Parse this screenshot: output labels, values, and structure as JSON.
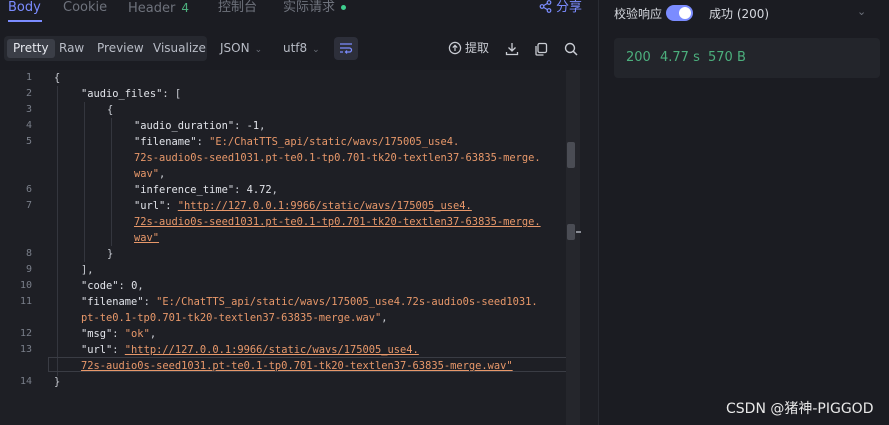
{
  "tabs": [
    {
      "label": "Body",
      "active": true
    },
    {
      "label": "Cookie"
    },
    {
      "label": "Header",
      "count": "4"
    },
    {
      "label": "控制台"
    },
    {
      "label": "实际请求"
    }
  ],
  "share_label": "分享",
  "view_modes": [
    "Pretty",
    "Raw",
    "Preview",
    "Visualize"
  ],
  "format_select": "JSON",
  "encoding_select": "utf8",
  "extract_label": "提取",
  "gutter": [
    "1",
    "2",
    "3",
    "4",
    "5",
    "",
    "",
    "6",
    "7",
    "",
    "",
    "8",
    "9",
    "10",
    "11",
    "",
    "12",
    "13",
    "",
    "14"
  ],
  "json_lines": [
    "{",
    "\"audio_files\": [",
    "{",
    "\"audio_duration\": -1,",
    "\"filename\": \"E:/ChatTTS_api/static/wavs/175005_use4.",
    "72s-audio0s-seed1031.pt-te0.1-tp0.701-tk20-textlen37-63835-merge.",
    "wav\",",
    "\"inference_time\": 4.72,",
    "\"url\": \"http://127.0.0.1:9966/static/wavs/175005_use4.",
    "72s-audio0s-seed1031.pt-te0.1-tp0.701-tk20-textlen37-63835-merge.",
    "wav\"",
    "}",
    "],",
    "\"code\": 0,",
    "\"filename\": \"E:/ChatTTS_api/static/wavs/175005_use4.72s-audio0s-seed1031.",
    "pt-te0.1-tp0.701-tk20-textlen37-63835-merge.wav\",",
    "\"msg\": \"ok\",",
    "\"url\": \"http://127.0.0.1:9966/static/wavs/175005_use4.",
    "72s-audio0s-seed1031.pt-te0.1-tp0.701-tk20-textlen37-63835-merge.wav\"",
    "}"
  ],
  "code": {
    "audio_files_key": "\"audio_files\"",
    "audio_duration_key": "\"audio_duration\"",
    "audio_duration_val": "-1",
    "filename_key": "\"filename\"",
    "filename1_a": "\"E:/ChatTTS_api/static/wavs/175005_use4.",
    "filename1_b": "72s-audio0s-seed1031.pt-te0.1-tp0.701-tk20-textlen37-63835-merge.",
    "filename1_c": "wav\"",
    "inference_time_key": "\"inference_time\"",
    "inference_time_val": "4.72",
    "url_key": "\"url\"",
    "url1_a": "\"http://127.0.0.1:9966/static/wavs/175005_use4.",
    "url1_b": "72s-audio0s-seed1031.pt-te0.1-tp0.701-tk20-textlen37-63835-merge.",
    "url1_c": "wav\"",
    "code_key": "\"code\"",
    "code_val": "0",
    "filename2_a": "\"E:/ChatTTS_api/static/wavs/175005_use4.72s-audio0s-seed1031.",
    "filename2_b": "pt-te0.1-tp0.701-tk20-textlen37-63835-merge.wav\"",
    "msg_key": "\"msg\"",
    "msg_val": "\"ok\"",
    "url2_a": "\"http://127.0.0.1:9966/static/wavs/175005_use4.",
    "url2_b": "72s-audio0s-seed1031.pt-te0.1-tp0.701-tk20-textlen37-63835-merge.wav\""
  },
  "response": {
    "verify_label": "校验响应",
    "verify_enabled": true,
    "result": "成功 (200)",
    "status": "200",
    "time": "4.77 s",
    "size": "570 B"
  },
  "watermark": "CSDN @猪神-PIGGOD",
  "colors": {
    "accent": "#7b8cff",
    "success": "#4caf7d",
    "string": "#e8986a"
  }
}
